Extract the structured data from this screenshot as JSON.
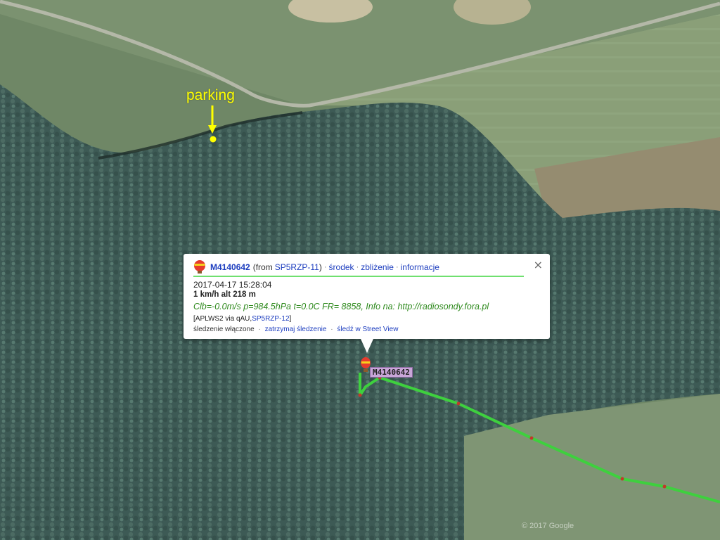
{
  "map": {
    "parking_label": "parking",
    "copyright": "© 2017 Google",
    "track_color": "#3ed03e",
    "parking_color": "#ffff00"
  },
  "marker": {
    "label": "M4140642",
    "icon": "balloon-icon"
  },
  "popup": {
    "callsign": "M4140642",
    "from_prefix": "(from",
    "from_station": "SP5RZP-11",
    "from_suffix": ")",
    "link_center": "środek",
    "link_zoom": "zbliżenie",
    "link_info": "informacje",
    "timestamp": "2017-04-17 15:28:04",
    "speed_alt": "1 km/h alt 218 m",
    "comment": "Clb=-0.0m/s p=984.5hPa t=0.0C FR= 8858, Info na: http://radiosondy.fora.pl",
    "path_prefix": "[APLWS2 via qAU,",
    "path_station": "SP5RZP-12",
    "path_suffix": "]",
    "tracking_on": "śledzenie włączone",
    "stop_tracking": "zatrzymaj śledzenie",
    "streetview": "śledź w Street View",
    "close": "×"
  }
}
